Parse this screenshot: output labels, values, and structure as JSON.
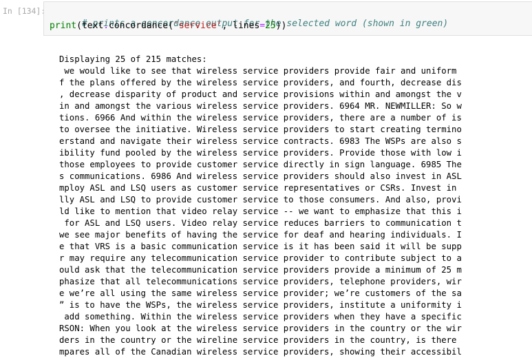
{
  "cell": {
    "prompt": "In [134]:",
    "code": {
      "comment": "# prints a concordance output for the selected word (shown in green)",
      "line2": {
        "func": "print",
        "open_paren": "(",
        "obj": "text",
        "dot": ".",
        "method": "concordance",
        "open_paren2": "(",
        "string": "'service'",
        "comma": ", ",
        "kwarg": "lines",
        "equals": "=",
        "number": "25",
        "close": "))"
      }
    }
  },
  "output": {
    "header": "Displaying 25 of 215 matches:",
    "lines": [
      " we would like to see that wireless service providers provide fair and uniform",
      "f the plans offered by the wireless service providers, and fourth, decrease dis",
      ", decrease disparity of product and service provisions within and amongst the v",
      "in and amongst the various wireless service providers. 6964 MR. NEWMILLER: So w",
      "tions. 6966 And within the wireless service providers, there are a number of is",
      "to oversee the initiative. Wireless service providers to start creating termino",
      "erstand and navigate their wireless service contracts. 6983 The WSPs are also s",
      "ibility fund pooled by the wireless service providers. Provide those with low i",
      "those employees to provide customer service directly in sign language. 6985 The",
      "s communications. 6986 And wireless service providers should also invest in ASL",
      "mploy ASL and LSQ users as customer service representatives or CSRs. Invest in",
      "lly ASL and LSQ to provide customer service to those consumers. And also, provi",
      "ld like to mention that video relay service -- we want to emphasize that this i",
      " for ASL and LSQ users. Video relay service reduces barriers to communication t",
      "we see major benefits of having the service for deaf and hearing individuals. I",
      "e that VRS is a basic communication service is it has been said it will be supp",
      "r may require any telecommunication service provider to contribute subject to a",
      "ould ask that the telecommunication service providers provide a minimum of 25 m",
      "phasize that all telecommunications service providers, telephone providers, wir",
      "e we’re all using the same wireless service provider; we’re customers of the sa",
      "” is to have the WSPs, the wireless service providers, institute a uniformity i",
      " add something. Within the wireless service providers when they have a specific",
      "RSON: When you look at the wireless service providers in the country or the wir",
      "ders in the country or the wireline service providers in the country, is there",
      "mpares all of the Canadian wireless service providers, showing their accessibil"
    ]
  }
}
